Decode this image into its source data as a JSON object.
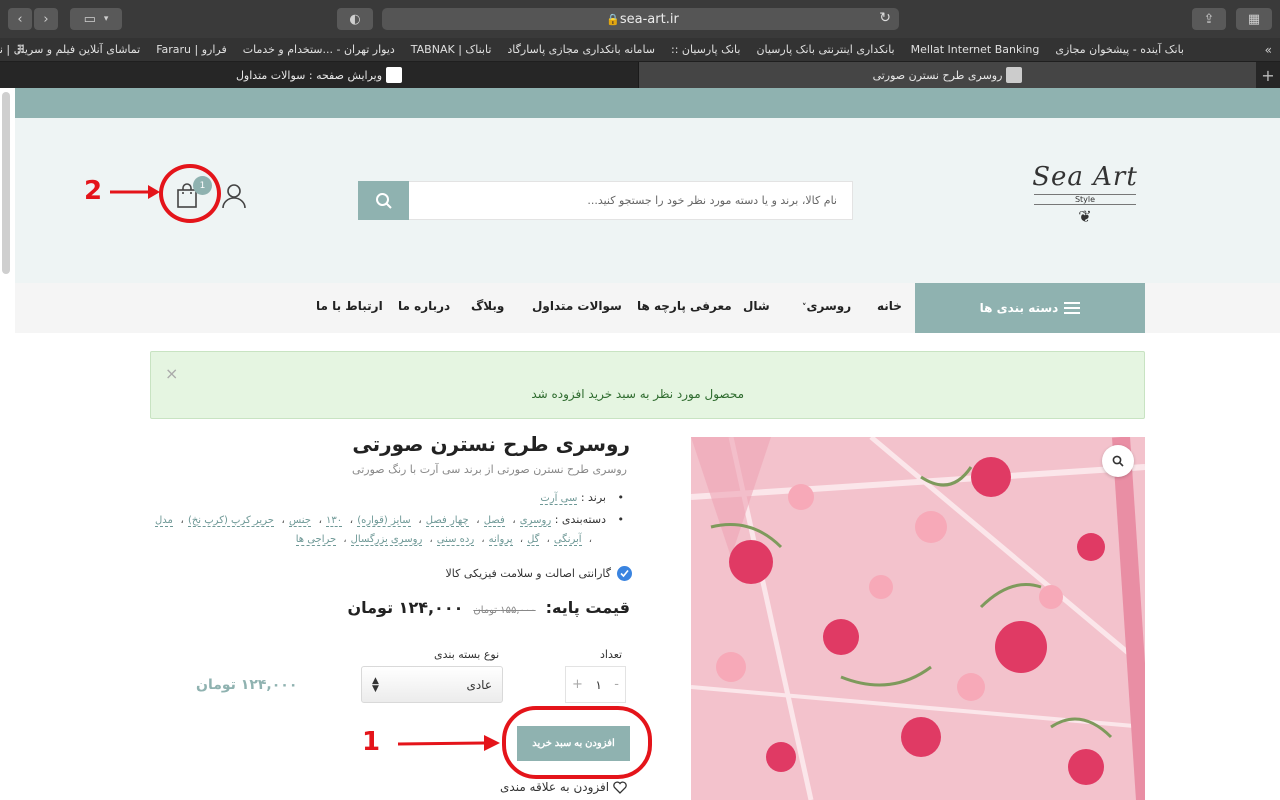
{
  "browser": {
    "url": "sea-art.ir",
    "bookmarks": [
      "بانک آینده - پیشخوان مجازی",
      "Mellat Internet Banking",
      "بانکداری اینترنتی بانک پارسیان",
      "بانک پارسیان ::",
      "سامانه بانکداری مجازی پاسارگاد",
      "تابناک | TABNAK",
      "دیوار تهران - ...ستخدام و خدمات",
      "فرارو | Fararu",
      "تماشای آنلاین فیلم و سریال | نماوا"
    ],
    "tabs": {
      "active": "روسری طرح نسترن صورتی",
      "inactive": "ویرایش صفحه : سوالات متداول"
    }
  },
  "header": {
    "logo_main": "Sea Art",
    "logo_sub": "Style",
    "search_placeholder": "نام کالا، برند و یا دسته مورد نظر خود را جستجو کنید...",
    "cart_count": "1"
  },
  "nav": {
    "categories_label": "دسته بندی ها",
    "items": [
      "خانه",
      "روسری",
      "شال",
      "معرفی پارچه ها",
      "سوالات متداول",
      "وبلاگ",
      "درباره ما",
      "ارتباط با ما"
    ]
  },
  "notice": {
    "text": "محصول مورد نظر به سبد خرید افزوده شد",
    "close": "×"
  },
  "product": {
    "title": "روسری طرح نسترن صورتی",
    "subtitle": "روسری طرح نسترن صورتی از برند سی آرت با رنگ صورتی",
    "brand_label": "برند :",
    "brand_value": "سی آرت",
    "category_label": "دسته‌بندی :",
    "categories": [
      "روسری",
      "فصل",
      "چهار فصل",
      "سایز (قواره)",
      "۱۳۰",
      "جنس",
      "حریر کرپ (کرپ نخ)",
      "مدل"
    ],
    "categories2": [
      "آبرنگی",
      "گل",
      "پروانه",
      "رده سنی",
      "روسری بزرگسال",
      "حراجی ها"
    ],
    "guarantee": "گارانتی اصالت و سلامت فیزیکی کالا",
    "price_label": "قیمت پایه:",
    "price_old": "۱۵۵,۰۰۰ تومان",
    "price_current": "۱۲۴,۰۰۰ تومان",
    "qty_label": "تعداد",
    "qty_value": "۱",
    "pack_label": "نوع بسته بندی",
    "pack_selected": "عادی",
    "total_price": "۱۲۴,۰۰۰ تومان",
    "add_to_cart": "افزودن به سبد خرید",
    "wishlist": "افزودن به علاقه مندی"
  },
  "annotations": {
    "num1": "1",
    "num2": "2"
  },
  "colors": {
    "accent": "#8fb2b0",
    "annotation": "#e4141a",
    "notice_bg": "#e5f5e1"
  }
}
